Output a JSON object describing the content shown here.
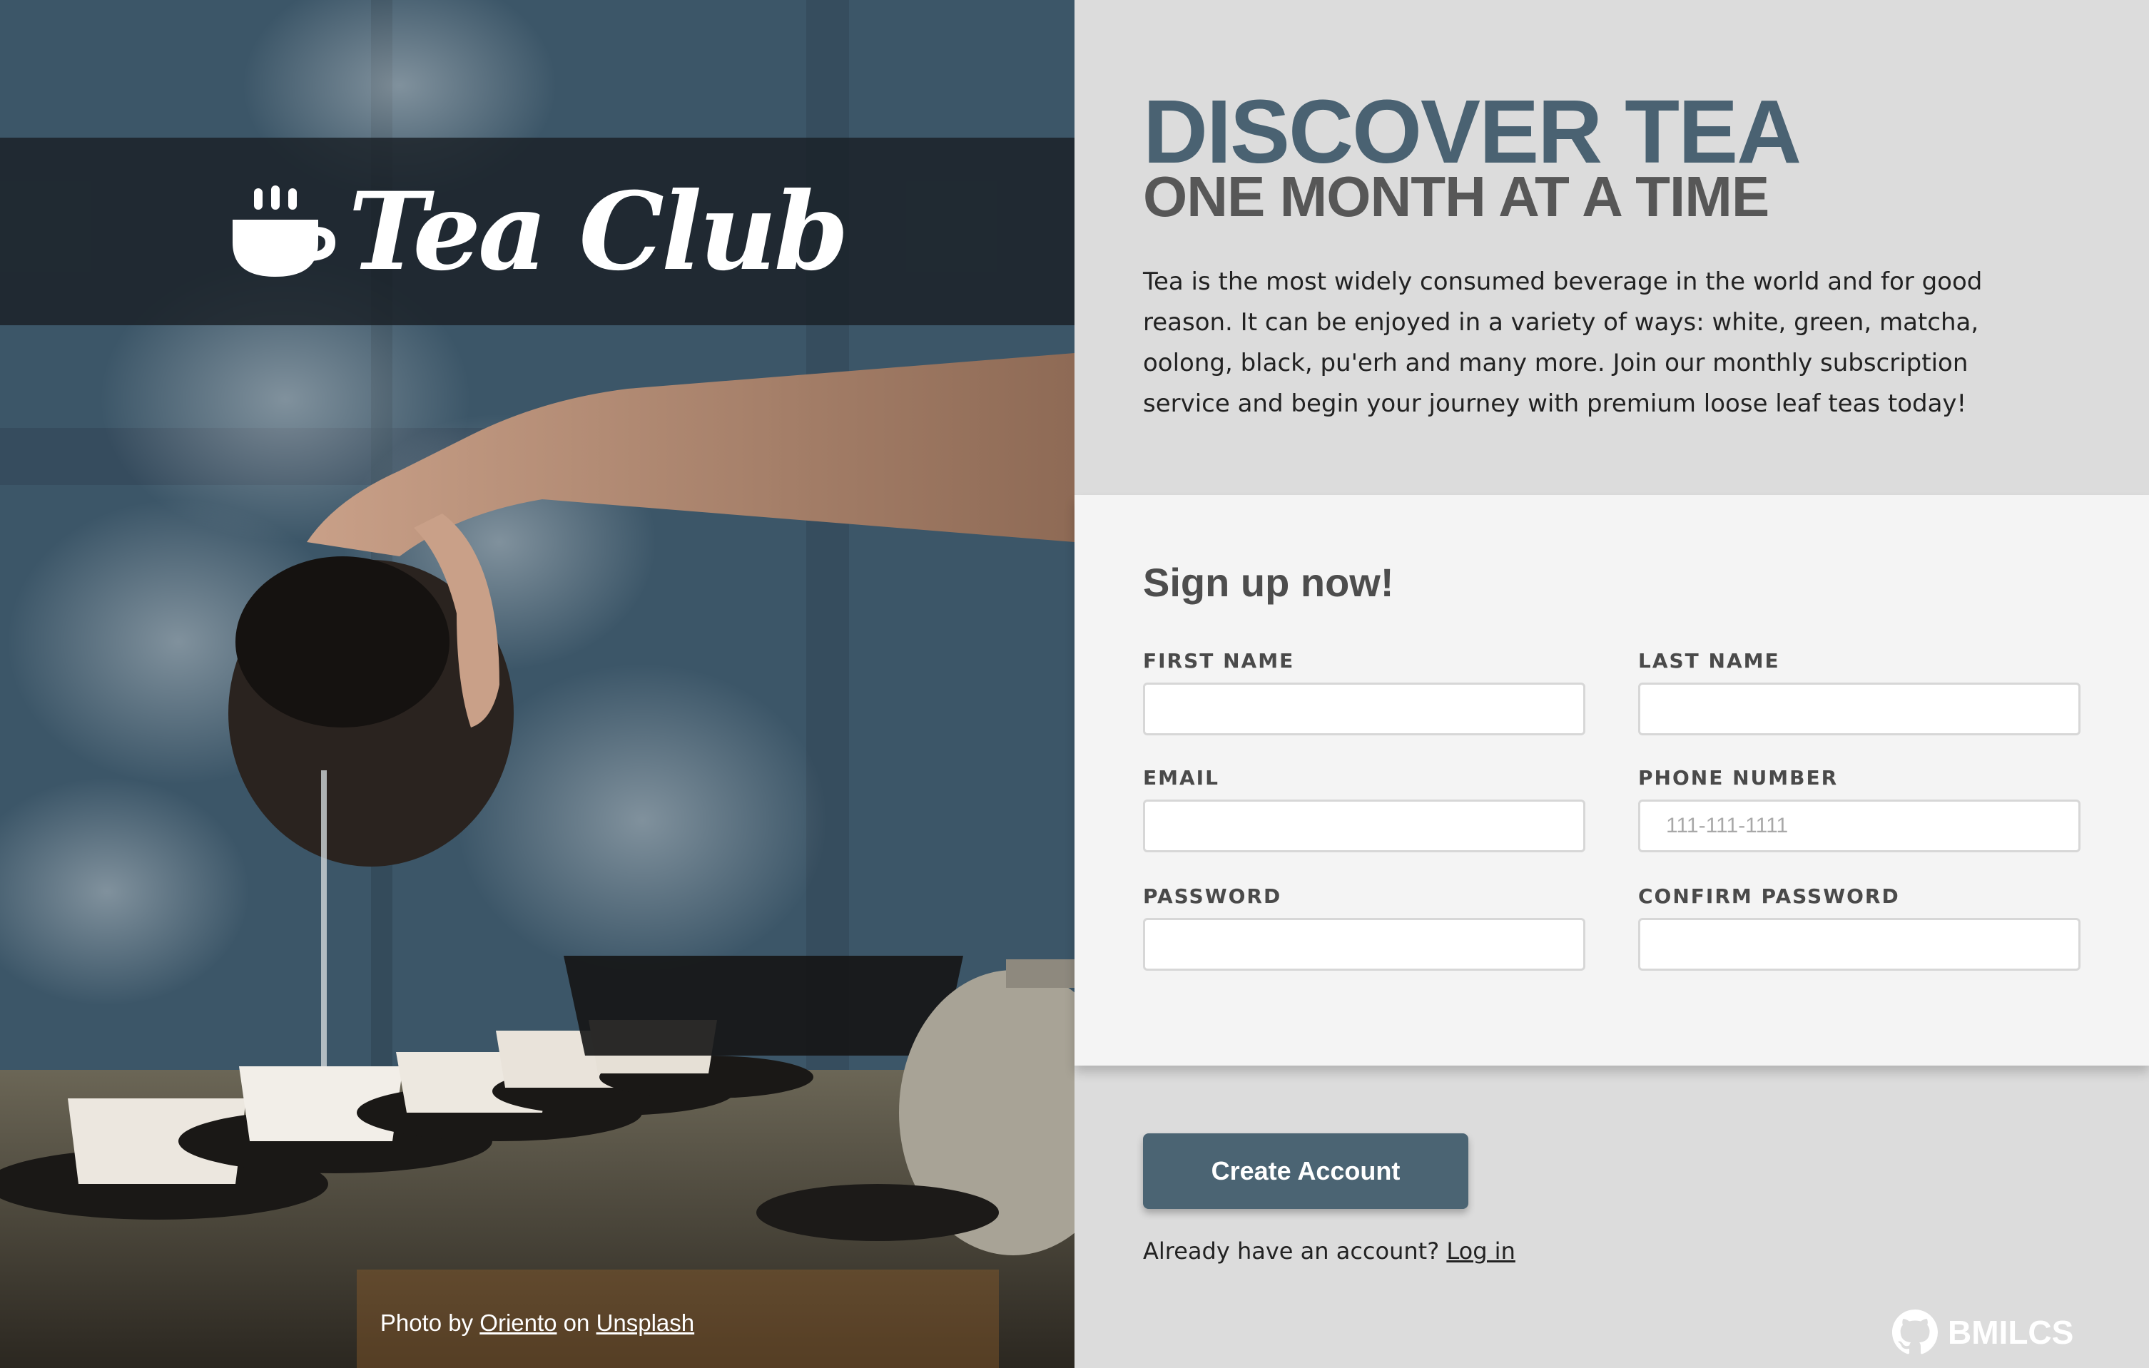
{
  "hero": {
    "logo_text": "Tea Club",
    "credit": {
      "prefix": "Photo by",
      "author": "Oriento",
      "middle": "on",
      "site": "Unsplash"
    }
  },
  "main": {
    "headline": "DISCOVER TEA",
    "subheadline": "ONE MONTH AT A TIME",
    "intro": "Tea is the most widely consumed beverage in the world and for good reason. It can be enjoyed in a variety of ways: white, green, matcha, oolong, black, pu'erh and many more. Join our monthly subscription service and begin your journey with premium loose leaf teas today!"
  },
  "form": {
    "title": "Sign up now!",
    "fields": {
      "first_name": {
        "label": "FIRST NAME",
        "value": "",
        "placeholder": ""
      },
      "last_name": {
        "label": "LAST NAME",
        "value": "",
        "placeholder": ""
      },
      "email": {
        "label": "EMAIL",
        "value": "",
        "placeholder": ""
      },
      "phone": {
        "label": "PHONE NUMBER",
        "value": "",
        "placeholder": "111-111-1111"
      },
      "password": {
        "label": "PASSWORD",
        "value": "",
        "placeholder": ""
      },
      "confirm_password": {
        "label": "CONFIRM PASSWORD",
        "value": "",
        "placeholder": ""
      }
    },
    "submit_label": "Create Account",
    "login_prompt": "Already have an account?",
    "login_link": "Log in"
  },
  "footer": {
    "brand": "BMILCS",
    "brand_icon": "github-icon"
  },
  "colors": {
    "accent": "#4b6473",
    "headline": "#4a6272",
    "panel": "#f4f4f4",
    "background": "#dcdcdc"
  }
}
